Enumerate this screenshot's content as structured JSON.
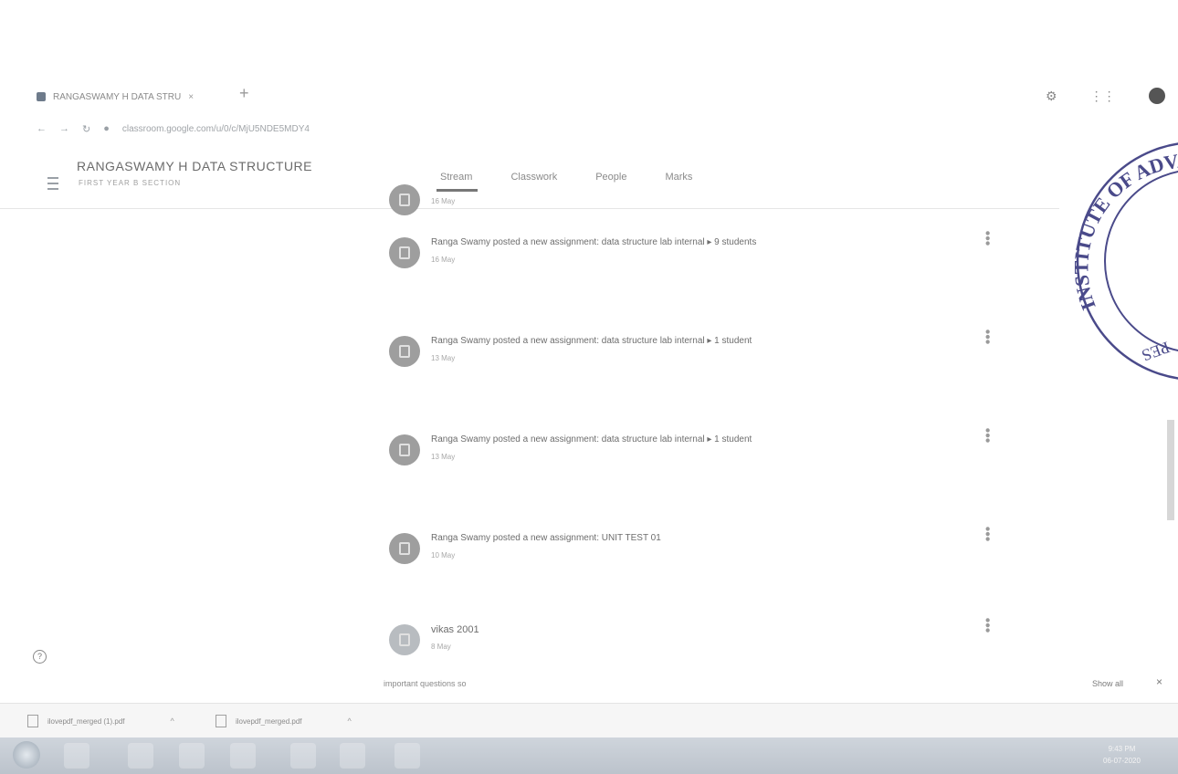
{
  "browser": {
    "tab_title": "RANGASWAMY H DATA STRU",
    "tab_close": "×",
    "new_tab": "+",
    "url": "classroom.google.com/u/0/c/MjU5NDE5MDY4"
  },
  "classroom": {
    "title": "RANGASWAMY H DATA STRUCTURE",
    "subtitle": "FIRST YEAR B SECTION",
    "tabs": [
      "Stream",
      "Classwork",
      "People",
      "Marks"
    ]
  },
  "stream": [
    {
      "type": "assignment",
      "text": "",
      "date": "16 May"
    },
    {
      "type": "assignment",
      "text": "Ranga Swamy posted a new assignment: data structure lab internal  ▸  9 students",
      "date": "16 May"
    },
    {
      "type": "assignment",
      "text": "Ranga Swamy posted a new assignment: data structure lab internal  ▸  1 student",
      "date": "13 May"
    },
    {
      "type": "assignment",
      "text": "Ranga Swamy posted a new assignment: data structure lab internal  ▸  1 student",
      "date": "13 May"
    },
    {
      "type": "assignment",
      "text": "Ranga Swamy posted a new assignment: UNIT TEST 01",
      "date": "10 May"
    },
    {
      "type": "user_post",
      "text": "vikas 2001",
      "date": "8 May",
      "comment": "important questions so"
    }
  ],
  "downloads": [
    {
      "name": "ilovepdf_merged (1).pdf"
    },
    {
      "name": "ilovepdf_merged.pdf"
    }
  ],
  "downloads_show_all": "Show all",
  "downloads_close": "×",
  "help": "?",
  "stamp_text": "INSTITUTE OF ADVANCED MAN",
  "stamp_bottom": "PES",
  "clock": {
    "time": "9:43 PM",
    "date": "06-07-2020"
  },
  "colors": {
    "header_text": "#6b6b6b",
    "stamp": "#4a4a8a",
    "taskbar": "#c4cbd3"
  }
}
